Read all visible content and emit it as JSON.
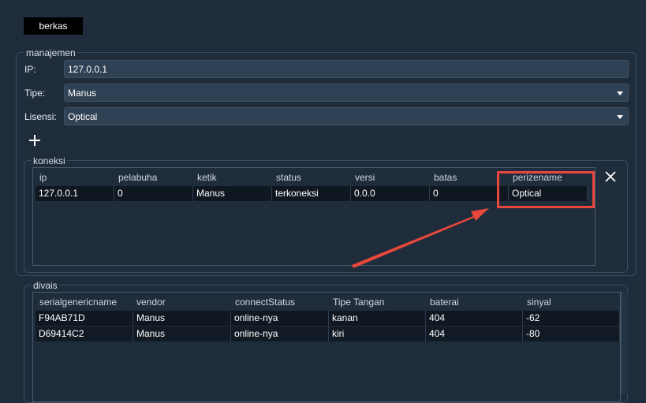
{
  "menu": {
    "file_label": "berkas"
  },
  "management": {
    "title": "manajemen",
    "ip_label": "IP:",
    "ip_value": "127.0.0.1",
    "type_label": "Tipe:",
    "type_value": "Manus",
    "license_label": "Lisensi:",
    "license_value": "Optical",
    "add_icon": "plus-icon"
  },
  "connections": {
    "title": "koneksi",
    "columns": [
      "ip",
      "pelabuha",
      "ketik",
      "status",
      "versi",
      "batas",
      "perizename"
    ],
    "rows": [
      [
        "127.0.0.1",
        "0",
        "Manus",
        "terkoneksi",
        "0.0.0",
        "0",
        "Optical"
      ]
    ],
    "close_icon": "close-icon"
  },
  "devices": {
    "title": "divais",
    "columns": [
      "serialgenericname",
      "vendor",
      "connectStatus",
      "Tipe Tangan",
      "baterai",
      "sinyal"
    ],
    "rows": [
      [
        "F94AB71D",
        "Manus",
        "online-nya",
        "kanan",
        "404",
        "-62"
      ],
      [
        "D69414C2",
        "Manus",
        "online-nya",
        "kiri",
        "404",
        "-80"
      ]
    ]
  },
  "colors": {
    "highlight": "#e8483c",
    "accent_arrow": "#e8483c"
  }
}
